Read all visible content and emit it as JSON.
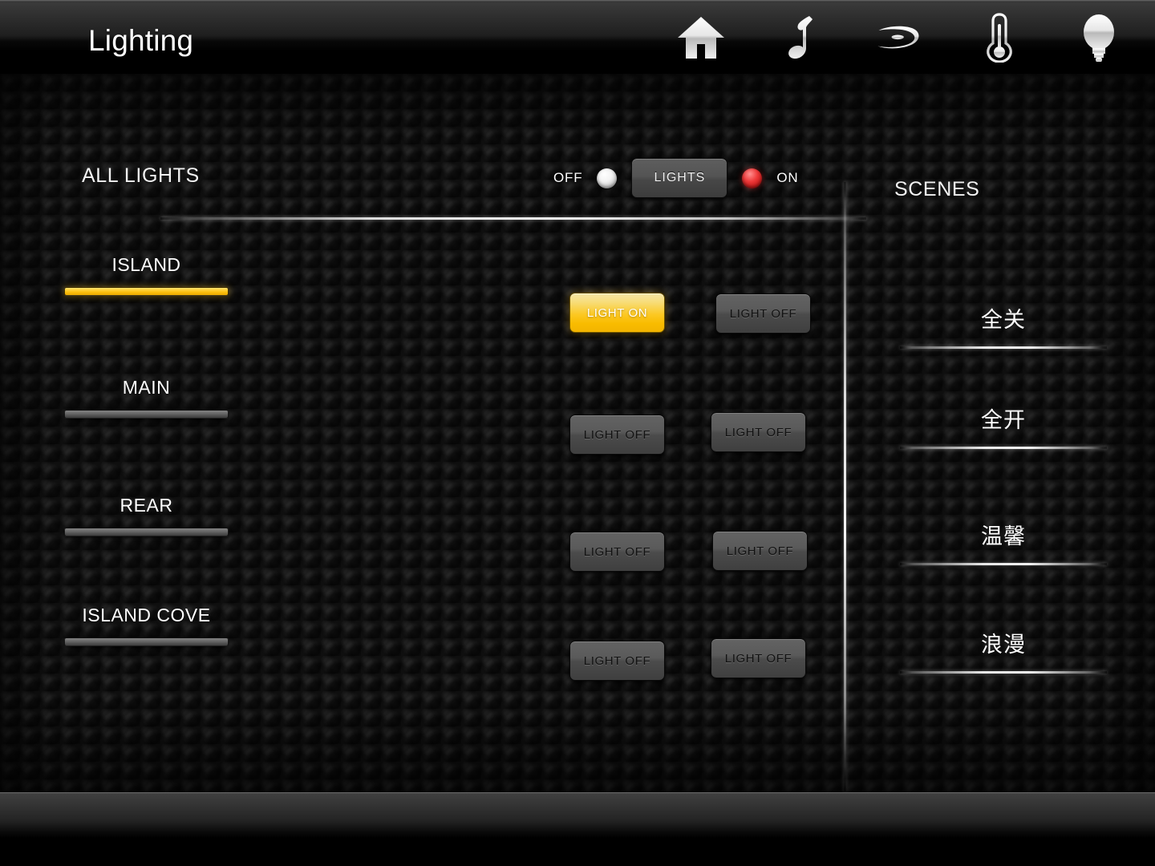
{
  "header": {
    "title": "Lighting",
    "nav_icons": [
      {
        "name": "home-icon",
        "label": "Home"
      },
      {
        "name": "music-note-icon",
        "label": "Music"
      },
      {
        "name": "bluray-icon",
        "label": "Blu-ray"
      },
      {
        "name": "thermometer-icon",
        "label": "Climate"
      },
      {
        "name": "light-bulb-icon",
        "label": "Lighting"
      }
    ]
  },
  "all_lights": {
    "label": "ALL LIGHTS",
    "off_label": "OFF",
    "on_label": "ON",
    "button_label": "LIGHTS",
    "off_led_color": "#f3f3f3",
    "on_led_color": "#ef3a3a"
  },
  "zones": [
    {
      "label": "ISLAND",
      "state": "on",
      "bar_color": "#fcbf0d"
    },
    {
      "label": "MAIN",
      "state": "off",
      "bar_color": "#6d6d6d"
    },
    {
      "label": "REAR",
      "state": "off",
      "bar_color": "#6d6d6d"
    },
    {
      "label": "ISLAND COVE",
      "state": "off",
      "bar_color": "#6d6d6d"
    }
  ],
  "light_buttons": [
    {
      "label": "LIGHT ON",
      "state": "on"
    },
    {
      "label": "LIGHT OFF",
      "state": "off"
    },
    {
      "label": "LIGHT OFF",
      "state": "off"
    },
    {
      "label": "LIGHT OFF",
      "state": "off"
    },
    {
      "label": "LIGHT OFF",
      "state": "off"
    },
    {
      "label": "LIGHT OFF",
      "state": "off"
    },
    {
      "label": "LIGHT OFF",
      "state": "off"
    },
    {
      "label": "LIGHT OFF",
      "state": "off"
    }
  ],
  "scenes": {
    "label": "SCENES",
    "items": [
      {
        "label": "全关"
      },
      {
        "label": "全开"
      },
      {
        "label": "温馨"
      },
      {
        "label": "浪漫"
      }
    ]
  },
  "colors": {
    "accent": "#fcbf0d",
    "background": "#1d1d1d",
    "text": "#ffffff"
  }
}
